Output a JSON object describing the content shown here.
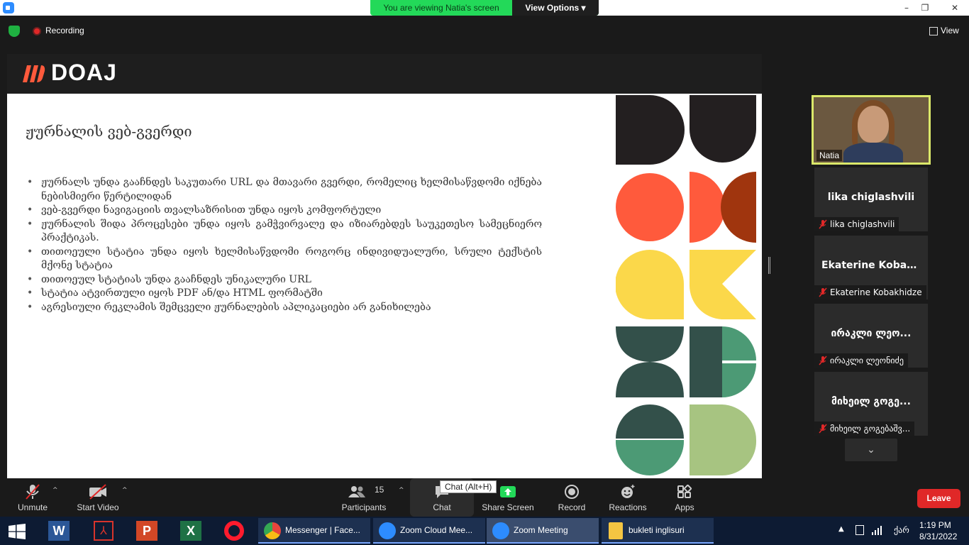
{
  "title_bar": {
    "viewing_banner": "You are viewing Natia's screen",
    "view_options": "View Options ▾",
    "minimize": "–",
    "restore": "❐",
    "close": "✕"
  },
  "top_bar": {
    "recording": "Recording",
    "view": "View"
  },
  "slide": {
    "brand": "DOAJ",
    "title": "ჟურნალის ვებ-გვერდი",
    "bullets": [
      "ჟურნალს უნდა გააჩნდეს საკუთარი URL და მთავარი გვერდი, რომელიც ხელმისაწვდომი იქნება ნებისმიერი წერტილიდან",
      "ვებ-გვერდი ნავიგაციის თვალსაზრისით უნდა იყოს კომფორტული",
      "ჟურნალის შიდა პროცესები უნდა იყოს გამჭვირვალე და იზიარებდეს საუკეთესო სამეცნიერო პრაქტიკას.",
      "თითოეული სტატია უნდა იყოს ხელმისაწვდომი როგორც ინდივიდუალური, სრული ტექსტის მქონე სტატია",
      "თითოეულ სტატიას უნდა გააჩნდეს უნიკალური URL",
      "სტატია ატვირთული იყოს PDF ან/და HTML ფორმატში",
      "აგრესიული რეკლამის შემცველი ჟურნალების აპლიკაციები არ განიხილება"
    ],
    "art_colors": {
      "dark": "#231f20",
      "orange": "#ff5a3c",
      "brown": "#a0350e",
      "yellow": "#fbd84a",
      "teal": "#33504a",
      "green": "#4c9a75",
      "sage": "#a7c481"
    }
  },
  "participants_panel": {
    "self": {
      "name": "Natia"
    },
    "tiles": [
      {
        "display": "lika chiglashvili",
        "label": "lika chiglashvili"
      },
      {
        "display": "Ekaterine  Kobak...",
        "label": "Ekaterine Kobakhidze"
      },
      {
        "display": "ირაკლი ლეო...",
        "label": "ირაკლი ლეონიძე"
      },
      {
        "display": "მიხეილ გოგე...",
        "label": "მიხეილ გოგებაშვ..."
      }
    ],
    "scroll": "⌄"
  },
  "toolbar": {
    "unmute": "Unmute",
    "start_video": "Start Video",
    "participants": "Participants",
    "participants_count": "15",
    "chat": "Chat",
    "chat_tooltip": "Chat (Alt+H)",
    "share_screen": "Share Screen",
    "record": "Record",
    "reactions": "Reactions",
    "apps": "Apps",
    "leave": "Leave"
  },
  "taskbar": {
    "apps": [
      {
        "label": "Messenger | Face...",
        "icon": "chrome-icon",
        "color": "#e8453c"
      },
      {
        "label": "Zoom Cloud Mee...",
        "icon": "zoom-icon",
        "color": "#2d8cff"
      },
      {
        "label": "Zoom Meeting",
        "icon": "zoom-icon",
        "color": "#2d8cff"
      },
      {
        "label": "bukleti inglisuri",
        "icon": "folder-icon",
        "color": "#f4c542"
      }
    ],
    "lang": "ქარ",
    "time": "1:19 PM",
    "date": "8/31/2022"
  }
}
